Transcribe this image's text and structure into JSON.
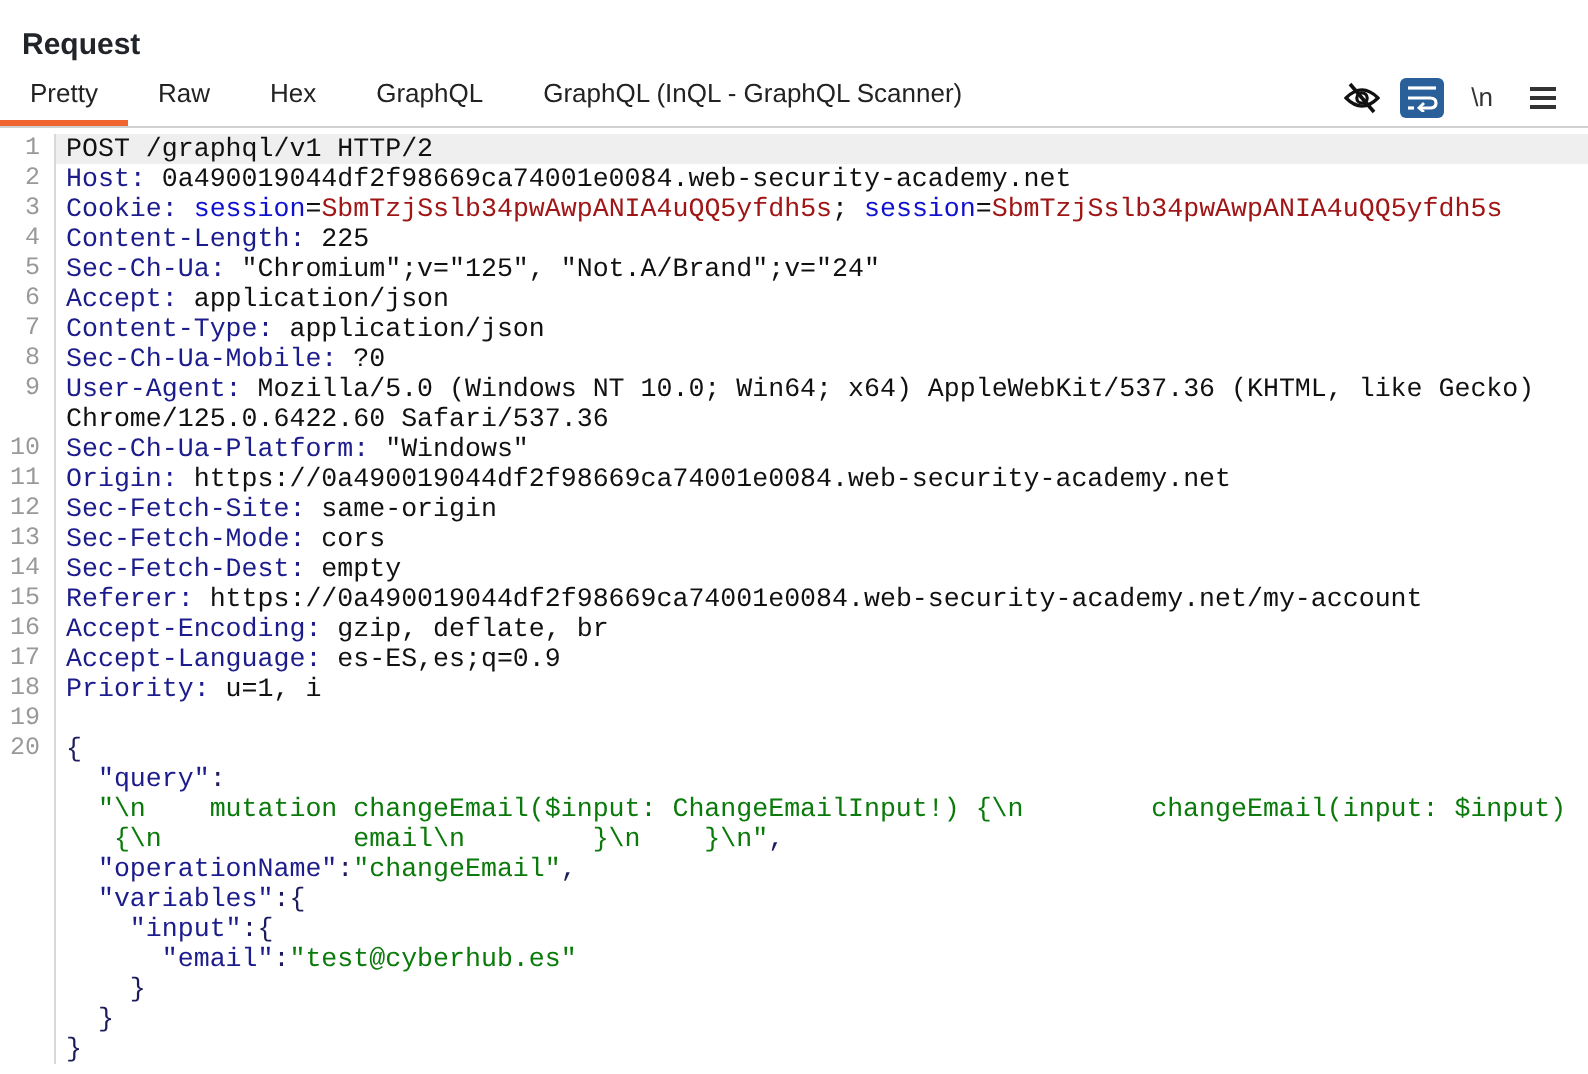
{
  "title": "Request",
  "tabs": [
    {
      "label": "Pretty",
      "selected": true
    },
    {
      "label": "Raw",
      "selected": false
    },
    {
      "label": "Hex",
      "selected": false
    },
    {
      "label": "GraphQL",
      "selected": false
    },
    {
      "label": "GraphQL (InQL - GraphQL Scanner)",
      "selected": false
    }
  ],
  "toolbar": {
    "wrap_on": true,
    "newline_label": "\\n"
  },
  "rows": [
    {
      "number": "1",
      "selected": true,
      "segments": [
        {
          "kind": "plain",
          "text": "POST /graphql/v1 HTTP/2"
        }
      ]
    },
    {
      "number": "2",
      "selected": false,
      "segments": [
        {
          "kind": "name",
          "text": "Host:"
        },
        {
          "kind": "plain",
          "text": " 0a490019044df2f98669ca74001e0084.web-security-academy.net"
        }
      ]
    },
    {
      "number": "3",
      "selected": false,
      "segments": [
        {
          "kind": "name",
          "text": "Cookie:"
        },
        {
          "kind": "cookie-name",
          "text": " session"
        },
        {
          "kind": "plain",
          "text": "="
        },
        {
          "kind": "cookie-value",
          "text": "SbmTzjSslb34pwAwpANIA4uQQ5yfdh5s"
        },
        {
          "kind": "plain",
          "text": "; "
        },
        {
          "kind": "cookie-name",
          "text": "session"
        },
        {
          "kind": "plain",
          "text": "="
        },
        {
          "kind": "cookie-value",
          "text": "SbmTzjSslb34pwAwpANIA4uQQ5yfdh5s"
        }
      ]
    },
    {
      "number": "4",
      "selected": false,
      "segments": [
        {
          "kind": "name",
          "text": "Content-Length:"
        },
        {
          "kind": "plain",
          "text": " 225"
        }
      ]
    },
    {
      "number": "5",
      "selected": false,
      "segments": [
        {
          "kind": "name",
          "text": "Sec-Ch-Ua:"
        },
        {
          "kind": "plain",
          "text": " \"Chromium\";v=\"125\", \"Not.A/Brand\";v=\"24\""
        }
      ]
    },
    {
      "number": "6",
      "selected": false,
      "segments": [
        {
          "kind": "name",
          "text": "Accept:"
        },
        {
          "kind": "plain",
          "text": " application/json"
        }
      ]
    },
    {
      "number": "7",
      "selected": false,
      "segments": [
        {
          "kind": "name",
          "text": "Content-Type:"
        },
        {
          "kind": "plain",
          "text": " application/json"
        }
      ]
    },
    {
      "number": "8",
      "selected": false,
      "segments": [
        {
          "kind": "name",
          "text": "Sec-Ch-Ua-Mobile:"
        },
        {
          "kind": "plain",
          "text": " ?0"
        }
      ]
    },
    {
      "number": "9",
      "selected": false,
      "segments": [
        {
          "kind": "name",
          "text": "User-Agent:"
        },
        {
          "kind": "plain",
          "text": " Mozilla/5.0 (Windows NT 10.0; Win64; x64) AppleWebKit/537.36 (KHTML, like Gecko)"
        }
      ]
    },
    {
      "selected": false,
      "segments": [
        {
          "kind": "plain",
          "text": "Chrome/125.0.6422.60 Safari/537.36"
        }
      ]
    },
    {
      "number": "10",
      "selected": false,
      "segments": [
        {
          "kind": "name",
          "text": "Sec-Ch-Ua-Platform:"
        },
        {
          "kind": "plain",
          "text": " \"Windows\""
        }
      ]
    },
    {
      "number": "11",
      "selected": false,
      "segments": [
        {
          "kind": "name",
          "text": "Origin:"
        },
        {
          "kind": "plain",
          "text": " https://0a490019044df2f98669ca74001e0084.web-security-academy.net"
        }
      ]
    },
    {
      "number": "12",
      "selected": false,
      "segments": [
        {
          "kind": "name",
          "text": "Sec-Fetch-Site:"
        },
        {
          "kind": "plain",
          "text": " same-origin"
        }
      ]
    },
    {
      "number": "13",
      "selected": false,
      "segments": [
        {
          "kind": "name",
          "text": "Sec-Fetch-Mode:"
        },
        {
          "kind": "plain",
          "text": " cors"
        }
      ]
    },
    {
      "number": "14",
      "selected": false,
      "segments": [
        {
          "kind": "name",
          "text": "Sec-Fetch-Dest:"
        },
        {
          "kind": "plain",
          "text": " empty"
        }
      ]
    },
    {
      "number": "15",
      "selected": false,
      "segments": [
        {
          "kind": "name",
          "text": "Referer:"
        },
        {
          "kind": "plain",
          "text": " https://0a490019044df2f98669ca74001e0084.web-security-academy.net/my-account"
        }
      ]
    },
    {
      "number": "16",
      "selected": false,
      "segments": [
        {
          "kind": "name",
          "text": "Accept-Encoding:"
        },
        {
          "kind": "plain",
          "text": " gzip, deflate, br"
        }
      ]
    },
    {
      "number": "17",
      "selected": false,
      "segments": [
        {
          "kind": "name",
          "text": "Accept-Language:"
        },
        {
          "kind": "plain",
          "text": " es-ES,es;q=0.9"
        }
      ]
    },
    {
      "number": "18",
      "selected": false,
      "segments": [
        {
          "kind": "name",
          "text": "Priority:"
        },
        {
          "kind": "plain",
          "text": " u=1, i"
        }
      ]
    },
    {
      "number": "19",
      "selected": false
    },
    {
      "number": "20",
      "selected": false,
      "segments": [
        {
          "kind": "punct",
          "text": "{"
        }
      ]
    },
    {
      "selected": false,
      "segments": [
        {
          "kind": "json-key",
          "text": "  \"query\""
        },
        {
          "kind": "punct",
          "text": ":"
        }
      ]
    },
    {
      "selected": false,
      "segments": [
        {
          "kind": "json-string",
          "text": "  \"\\n    mutation changeEmail($input: ChangeEmailInput!) {\\n        changeEmail(input: $input)"
        }
      ]
    },
    {
      "selected": false,
      "segments": [
        {
          "kind": "json-string",
          "text": "   {\\n            email\\n        }\\n    }\\n\""
        },
        {
          "kind": "punct",
          "text": ","
        }
      ]
    },
    {
      "selected": false,
      "segments": [
        {
          "kind": "json-key",
          "text": "  \"operationName\""
        },
        {
          "kind": "punct",
          "text": ":"
        },
        {
          "kind": "json-string",
          "text": "\"changeEmail\""
        },
        {
          "kind": "punct",
          "text": ","
        }
      ]
    },
    {
      "selected": false,
      "segments": [
        {
          "kind": "json-key",
          "text": "  \"variables\""
        },
        {
          "kind": "punct",
          "text": ":{"
        }
      ]
    },
    {
      "selected": false,
      "segments": [
        {
          "kind": "json-key",
          "text": "    \"input\""
        },
        {
          "kind": "punct",
          "text": ":{"
        }
      ]
    },
    {
      "selected": false,
      "segments": [
        {
          "kind": "json-key",
          "text": "      \"email\""
        },
        {
          "kind": "punct",
          "text": ":"
        },
        {
          "kind": "json-string",
          "text": "\"test@cyberhub.es\""
        }
      ]
    },
    {
      "selected": false,
      "segments": [
        {
          "kind": "punct",
          "text": "    }"
        }
      ]
    },
    {
      "selected": false,
      "segments": [
        {
          "kind": "punct",
          "text": "  }"
        }
      ]
    },
    {
      "selected": false,
      "segments": [
        {
          "kind": "punct",
          "text": "}"
        }
      ]
    }
  ]
}
